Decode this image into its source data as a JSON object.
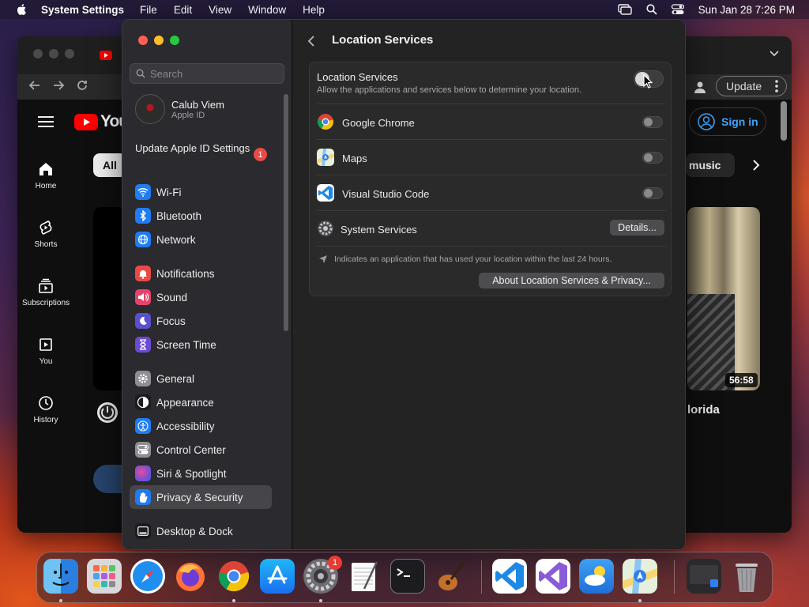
{
  "menubar": {
    "app_name": "System Settings",
    "menus": [
      "File",
      "Edit",
      "View",
      "Window",
      "Help"
    ],
    "datetime": "Sun Jan 28  7:26 PM"
  },
  "browser": {
    "update_label": "Update",
    "sign_in_label": "Sign in",
    "logo_text": "You",
    "chip_all": "All",
    "chip_music": "music",
    "nav": [
      {
        "label": "Home",
        "icon": "home-icon"
      },
      {
        "label": "Shorts",
        "icon": "shorts-icon"
      },
      {
        "label": "Subscriptions",
        "icon": "subscriptions-icon"
      },
      {
        "label": "You",
        "icon": "you-icon"
      },
      {
        "label": "History",
        "icon": "history-icon"
      }
    ],
    "video_duration": "56:58",
    "video_title_fragment": "lorida"
  },
  "settings": {
    "search_placeholder": "Search",
    "account": {
      "name": "Calub Viem",
      "sub": "Apple ID"
    },
    "update_apple_id": "Update Apple ID Settings",
    "update_badge": "1",
    "sidebar": [
      {
        "label": "Wi-Fi",
        "icon": "wifi-icon",
        "color": "#1f7cf2"
      },
      {
        "label": "Bluetooth",
        "icon": "bluetooth-icon",
        "color": "#1f7cf2"
      },
      {
        "label": "Network",
        "icon": "globe-icon",
        "color": "#1f7cf2"
      },
      {
        "label": "Notifications",
        "icon": "bell-icon",
        "color": "#ea4a44"
      },
      {
        "label": "Sound",
        "icon": "speaker-icon",
        "color": "#e8426a"
      },
      {
        "label": "Focus",
        "icon": "moon-icon",
        "color": "#5b4ecf"
      },
      {
        "label": "Screen Time",
        "icon": "hourglass-icon",
        "color": "#6a4bd1"
      },
      {
        "label": "General",
        "icon": "gear-icon",
        "color": "#8e8e93"
      },
      {
        "label": "Appearance",
        "icon": "appearance-icon",
        "color": "#1c1c1e"
      },
      {
        "label": "Accessibility",
        "icon": "accessibility-icon",
        "color": "#1f7cf2"
      },
      {
        "label": "Control Center",
        "icon": "control-center-icon",
        "color": "#8e8e93"
      },
      {
        "label": "Siri & Spotlight",
        "icon": "siri-icon",
        "color": "#7a4fd0"
      },
      {
        "label": "Privacy & Security",
        "icon": "hand-icon",
        "color": "#1f7cf2"
      },
      {
        "label": "Desktop & Dock",
        "icon": "dock-icon",
        "color": "#1c1c1e"
      }
    ],
    "selected": "Privacy & Security",
    "page_title": "Location Services",
    "location_services": {
      "title": "Location Services",
      "description": "Allow the applications and services below to determine your location.",
      "enabled": false
    },
    "apps": [
      {
        "label": "Google Chrome",
        "icon": "chrome-icon",
        "enabled": false
      },
      {
        "label": "Maps",
        "icon": "maps-icon",
        "enabled": false
      },
      {
        "label": "Visual Studio Code",
        "icon": "vscode-icon",
        "enabled": false
      }
    ],
    "system_services": {
      "label": "System Services",
      "button": "Details..."
    },
    "note": "Indicates an application that has used your location within the last 24 hours.",
    "about_button": "About Location Services & Privacy..."
  },
  "dock": {
    "items": [
      "finder-icon",
      "launchpad-icon",
      "safari-icon",
      "firefox-icon",
      "chrome-icon",
      "app-store-icon",
      "system-settings-icon",
      "textedit-icon",
      "terminal-icon",
      "garageband-icon",
      "vscode-icon",
      "visual-studio-icon",
      "weather-icon",
      "maps-icon",
      "screen-icon",
      "trash-icon"
    ],
    "settings_badge": "1"
  }
}
